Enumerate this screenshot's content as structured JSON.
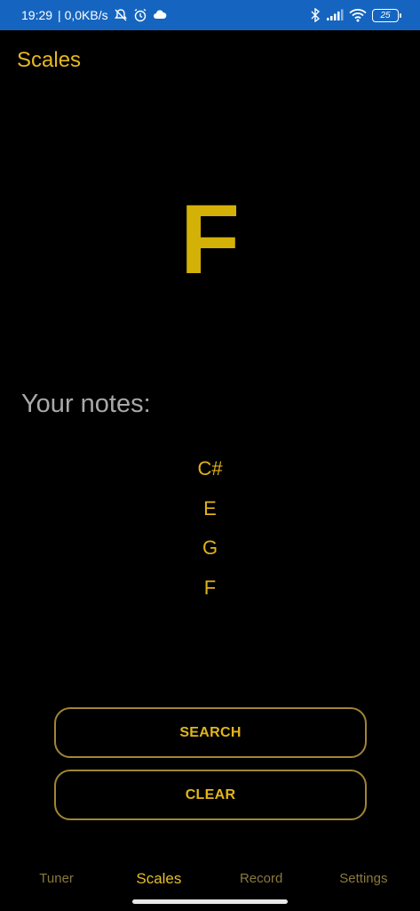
{
  "status_bar": {
    "time": "19:29",
    "speed": "| 0,0KB/s",
    "battery": "25",
    "icons": [
      "muted-bell-icon",
      "alarm-icon",
      "cloud-icon",
      "bluetooth-icon",
      "signal-icon",
      "wifi-icon",
      "battery-icon"
    ]
  },
  "app": {
    "title": "Scales",
    "accent_color": "#e3be2b"
  },
  "detected_note": "F",
  "notes_section": {
    "label": "Your notes:",
    "notes": [
      "C#",
      "E",
      "G",
      "F"
    ]
  },
  "buttons": {
    "search": "SEARCH",
    "clear": "CLEAR"
  },
  "nav": {
    "items": [
      "Tuner",
      "Scales",
      "Record",
      "Settings"
    ],
    "active": "Scales"
  }
}
